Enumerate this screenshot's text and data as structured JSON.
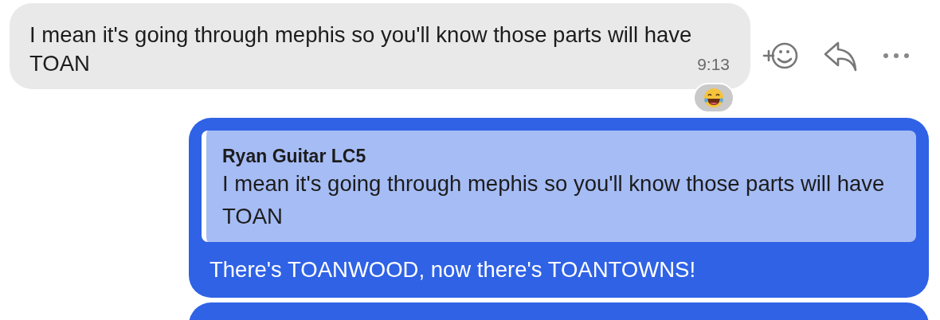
{
  "messages": [
    {
      "kind": "incoming",
      "text": "I mean it's going through mephis so you'll know those parts will have TOAN",
      "time": "9:13",
      "reactions": [
        {
          "kind": "laugh"
        }
      ]
    },
    {
      "kind": "outgoing",
      "quote": {
        "author": "Ryan Guitar LC5",
        "text": "I mean it's going through mephis so you'll know those parts will have TOAN"
      },
      "text": "There's TOANWOOD, now there's TOANTOWNS!"
    }
  ]
}
